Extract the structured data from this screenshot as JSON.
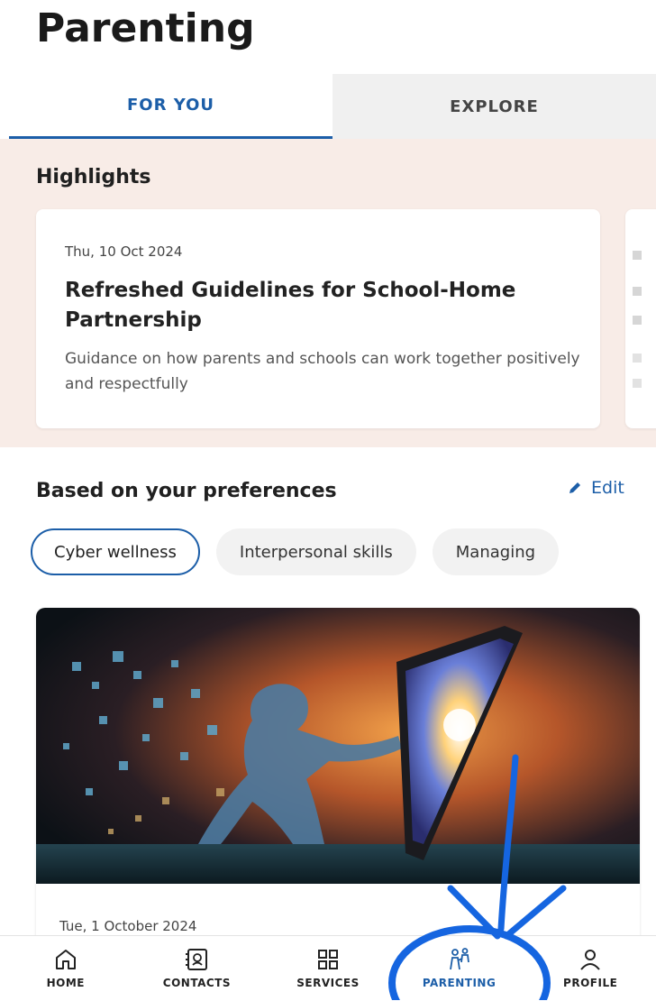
{
  "page": {
    "title": "Parenting"
  },
  "tabs": [
    {
      "label": "FOR YOU",
      "active": true
    },
    {
      "label": "EXPLORE",
      "active": false
    }
  ],
  "highlights": {
    "title": "Highlights",
    "cards": [
      {
        "date": "Thu, 10 Oct 2024",
        "title": "Refreshed Guidelines for School-Home Partnership",
        "description": "Guidance on how parents and schools can work together positively and respectfully"
      }
    ]
  },
  "preferences": {
    "title": "Based on your preferences",
    "edit_label": "Edit",
    "chips": [
      {
        "label": "Cyber wellness",
        "selected": true
      },
      {
        "label": "Interpersonal skills",
        "selected": false
      },
      {
        "label": "Managing",
        "selected": false
      }
    ]
  },
  "article": {
    "date": "Tue, 1 October 2024",
    "image_icon": "digital-figure-touching-tablet-image"
  },
  "bottom_nav": [
    {
      "label": "HOME",
      "icon": "home-icon"
    },
    {
      "label": "CONTACTS",
      "icon": "contacts-icon"
    },
    {
      "label": "SERVICES",
      "icon": "services-grid-icon"
    },
    {
      "label": "PARENTING",
      "icon": "parenting-icon",
      "active": true
    },
    {
      "label": "PROFILE",
      "icon": "profile-icon"
    }
  ],
  "colors": {
    "accent": "#1c5ea8",
    "highlights_bg": "#f8ece7",
    "annotation": "#1565e0"
  }
}
